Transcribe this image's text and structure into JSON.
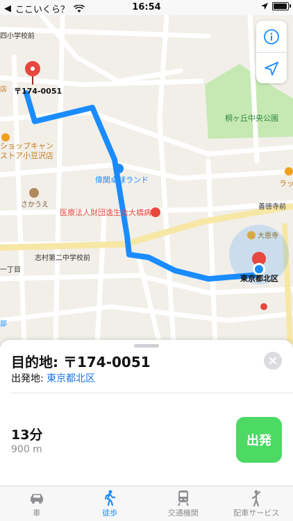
{
  "status_bar": {
    "carrier": "ここいくら？",
    "time": "16:54"
  },
  "map": {
    "labels": {
      "school_top": "四小学校前",
      "pin_label": "〒174-0051",
      "shop_line1": "ショップキャン",
      "shop_line2": "ストア小豆沢店",
      "clinic_top_left": "店",
      "park": "桐ヶ丘中央公園",
      "bowling": "偉関卓球ランド",
      "sakaue": "さかうえ",
      "hospital": "医療法人財団逸生会大橋病院",
      "zendokuji": "善徳寺前",
      "daionji": "大恩寺",
      "middle_school": "志村第二中学校前",
      "itchome": "一丁目",
      "current_location": "東京都北区",
      "rapp": "ラッ",
      "shibu": "部"
    }
  },
  "panel": {
    "title": "目的地: 〒174-0051",
    "from_label": "出発地:",
    "from_value": "東京都北区",
    "duration": "13分",
    "distance": "900 m",
    "go_label": "出発"
  },
  "tabs": [
    {
      "label": "車",
      "icon": "car-icon"
    },
    {
      "label": "徒歩",
      "icon": "walk-icon"
    },
    {
      "label": "交通機関",
      "icon": "train-icon"
    },
    {
      "label": "配車サービス",
      "icon": "ride-icon"
    }
  ],
  "colors": {
    "route": "#1a8cff",
    "go_button": "#4cd964",
    "active_tab": "#1a8cff",
    "pin": "#e8473d"
  }
}
